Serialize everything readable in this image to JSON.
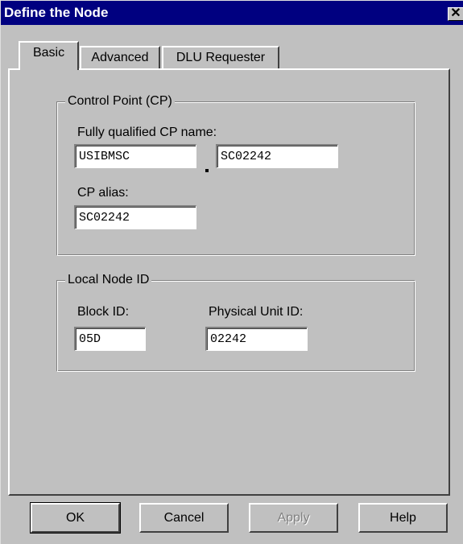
{
  "window": {
    "title": "Define the Node",
    "close_glyph": "✕"
  },
  "tabs": [
    {
      "label": "Basic",
      "active": true
    },
    {
      "label": "Advanced",
      "active": false
    },
    {
      "label": "DLU Requester",
      "active": false
    }
  ],
  "control_point": {
    "legend": "Control Point (CP)",
    "cp_name_label": "Fully qualified CP name:",
    "network_id": "USIBMSC",
    "cp_name": "SC02242",
    "cp_alias_label": "CP alias:",
    "cp_alias": "SC02242"
  },
  "local_node": {
    "legend": "Local Node ID",
    "block_id_label": "Block ID:",
    "block_id": "05D",
    "pu_id_label": "Physical Unit ID:",
    "pu_id": "02242"
  },
  "buttons": {
    "ok": "OK",
    "cancel": "Cancel",
    "apply": "Apply",
    "help": "Help"
  },
  "icons": {
    "close": "close-icon"
  },
  "colors": {
    "titlebar": "#000080",
    "face": "#c0c0c0"
  }
}
